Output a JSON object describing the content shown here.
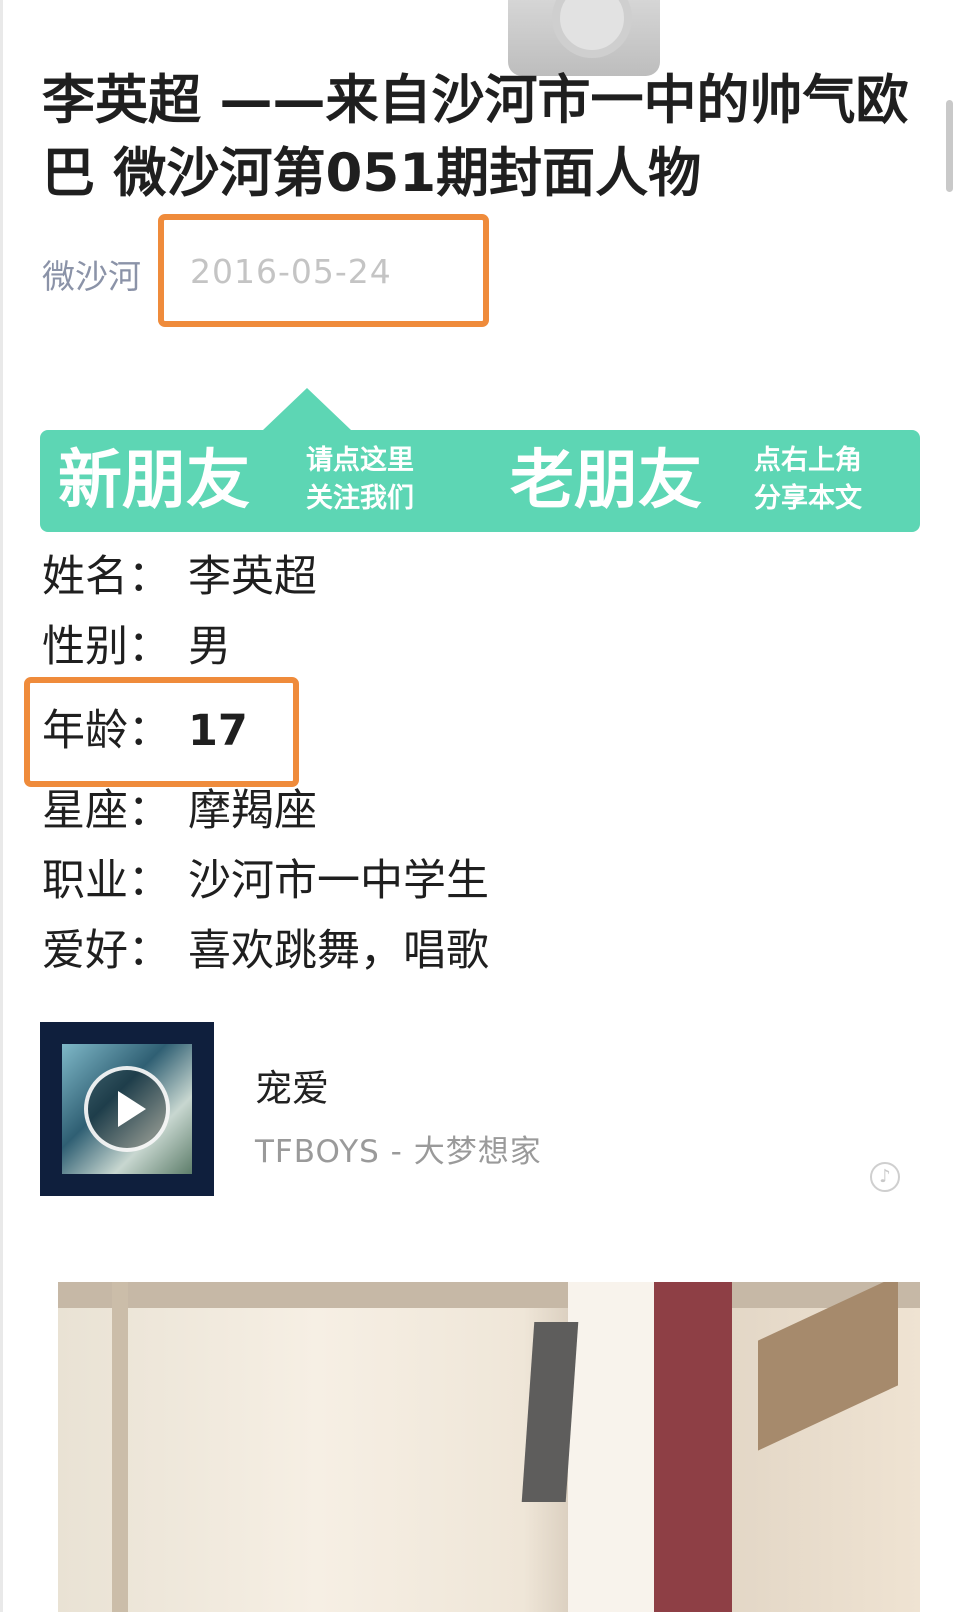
{
  "article": {
    "title": "李英超 ——来自沙河市一中的帅气欧巴 微沙河第051期封面人物",
    "account": "微沙河",
    "date": "2016-05-24"
  },
  "banner": {
    "left_big": "新朋友",
    "left_small_1": "请点这里",
    "left_small_2": "关注我们",
    "right_big": "老朋友",
    "right_small_1": "点右上角",
    "right_small_2": "分享本文"
  },
  "profile": [
    {
      "key": "姓名：",
      "value": "李英超"
    },
    {
      "key": "性别：",
      "value": "男"
    },
    {
      "key": "年龄：",
      "value": "17"
    },
    {
      "key": "星座：",
      "value": "摩羯座"
    },
    {
      "key": "职业：",
      "value": "沙河市一中学生"
    },
    {
      "key": "爱好：",
      "value": "喜欢跳舞，唱歌"
    }
  ],
  "music": {
    "title": "宠爱",
    "artist": "TFBOYS - 大梦想家",
    "play_icon": "play-icon",
    "note_icon": "music-note-icon"
  },
  "colors": {
    "banner": "#5dd6b4",
    "highlight": "#ef8b3b",
    "account": "#8b93a8"
  }
}
